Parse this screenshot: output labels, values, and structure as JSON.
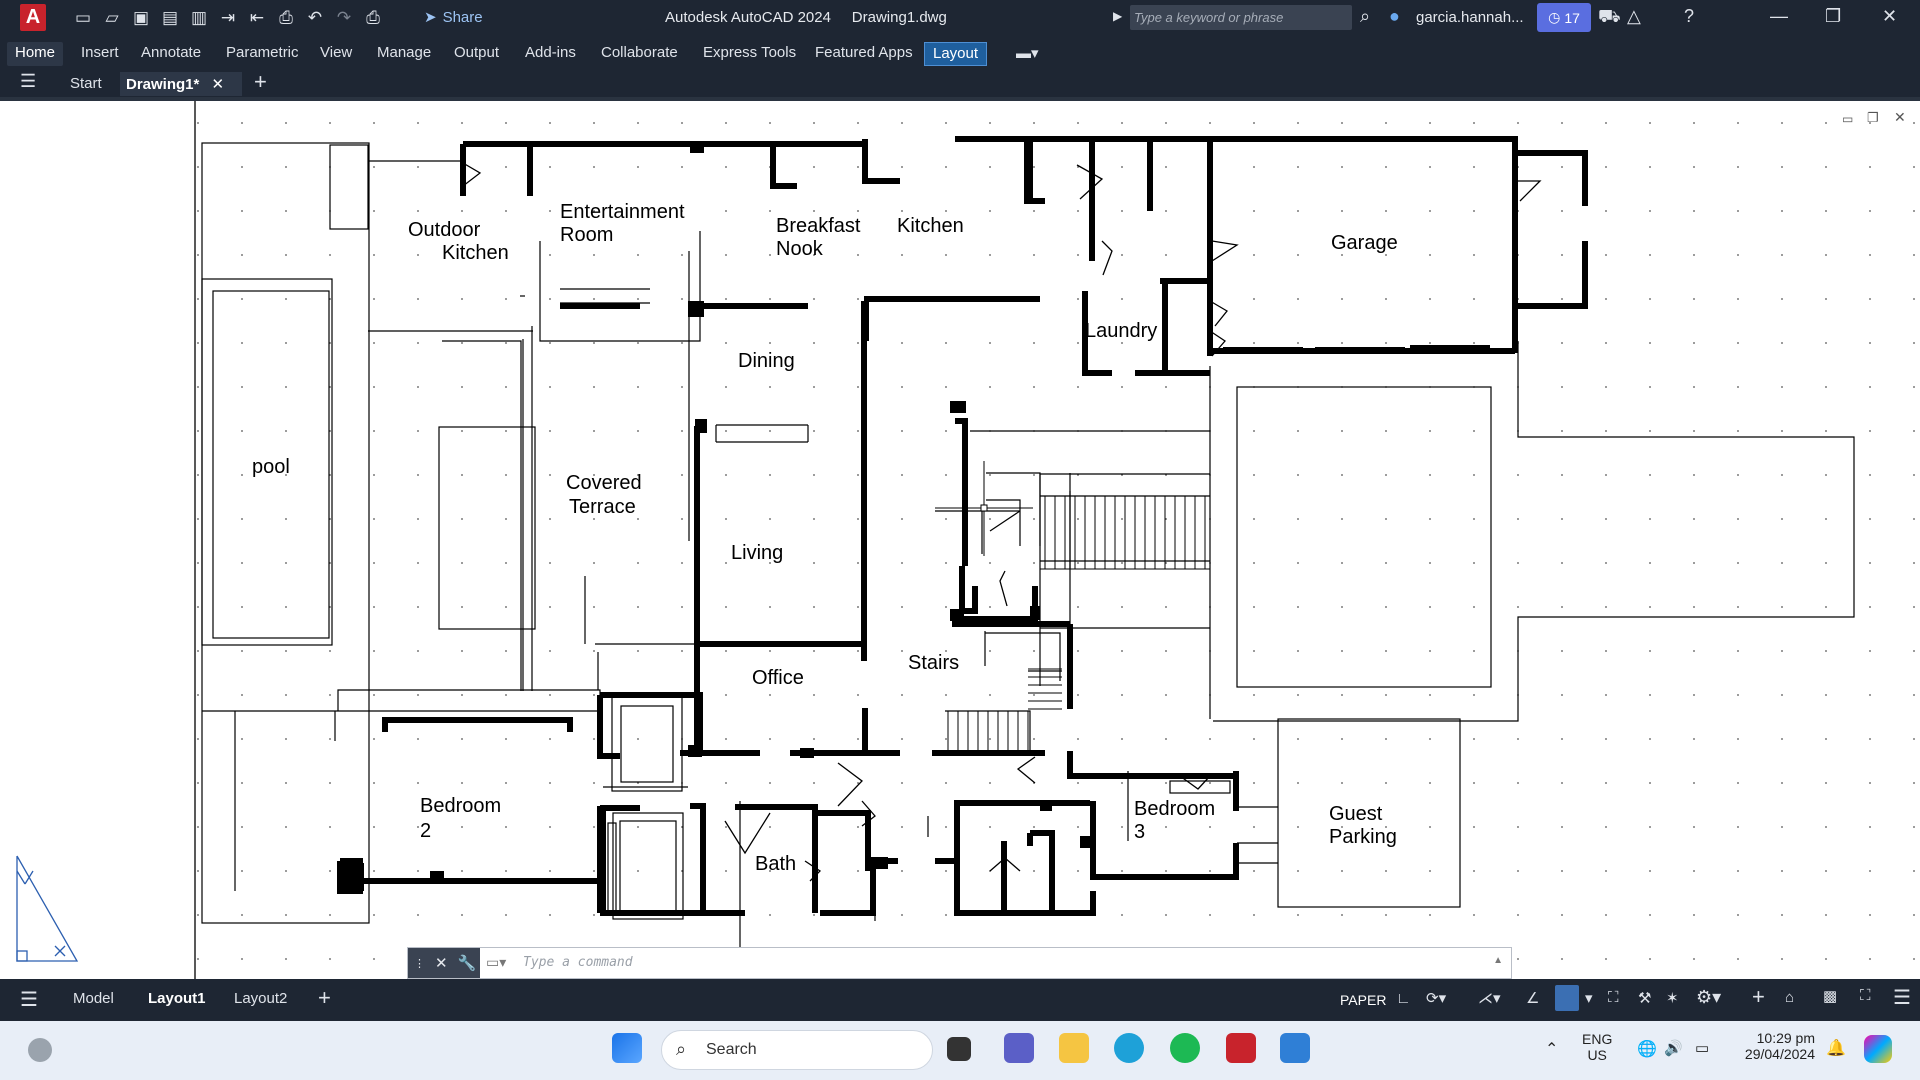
{
  "titlebar": {
    "app_logo": "A",
    "share_label": "Share",
    "title": "Autodesk AutoCAD 2024",
    "file": "Drawing1.dwg",
    "search_placeholder": "Type a keyword or phrase",
    "user": "garcia.hannah...",
    "badge_count": "17"
  },
  "ribbon": {
    "tabs": [
      "Home",
      "Insert",
      "Annotate",
      "Parametric",
      "View",
      "Manage",
      "Output",
      "Add-ins",
      "Collaborate",
      "Express Tools",
      "Featured Apps",
      "Layout"
    ]
  },
  "doctabs": {
    "start": "Start",
    "active": "Drawing1*"
  },
  "drawing": {
    "rooms": {
      "outdoor_kitchen_1": "Outdoor",
      "outdoor_kitchen_2": "Kitchen",
      "entertainment_1": "Entertainment",
      "entertainment_2": "Room",
      "breakfast_1": "Breakfast",
      "breakfast_2": "Nook",
      "kitchen": "Kitchen",
      "garage": "Garage",
      "laundry": "Laundry",
      "dining": "Dining",
      "pool": "pool",
      "covered_1": "Covered",
      "covered_2": "Terrace",
      "living": "Living",
      "office": "Office",
      "stairs": "Stairs",
      "bedroom2_1": "Bedroom",
      "bedroom2_2": "2",
      "bath": "Bath",
      "bedroom3_1": "Bedroom",
      "bedroom3_2": "3",
      "guest_1": "Guest",
      "guest_2": "Parking"
    }
  },
  "command": {
    "placeholder": "Type a command"
  },
  "statusbar": {
    "model": "Model",
    "layout1": "Layout1",
    "layout2": "Layout2",
    "paper": "PAPER"
  },
  "taskbar": {
    "search": "Search",
    "lang1": "ENG",
    "lang2": "US",
    "time": "10:29 pm",
    "date": "29/04/2024"
  }
}
